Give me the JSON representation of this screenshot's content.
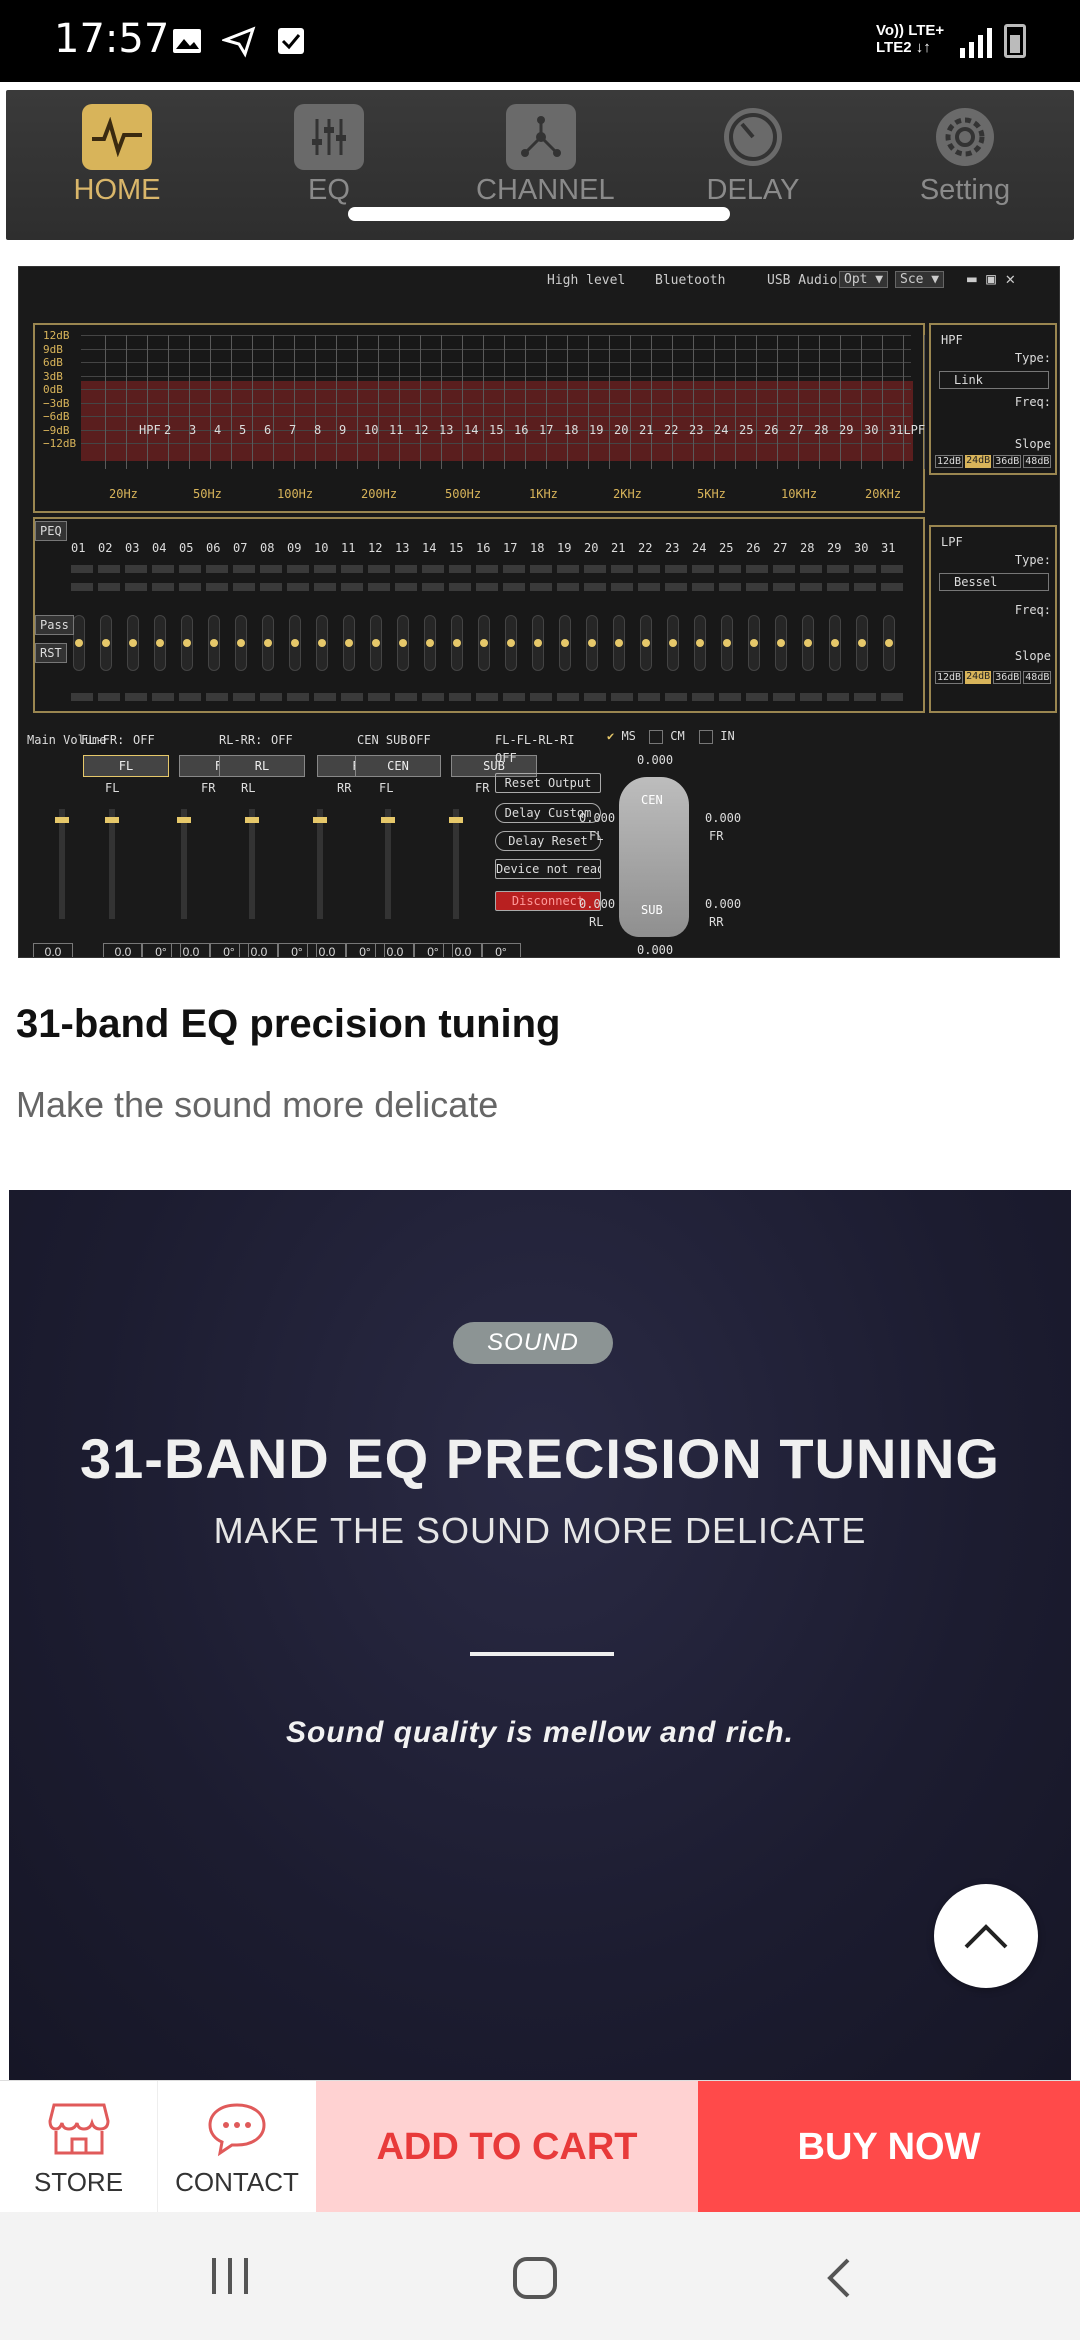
{
  "status_bar": {
    "time": "17:57",
    "network_line1": "Vo)) LTE+",
    "network_line2": "LTE2 ↓↑"
  },
  "app_nav": {
    "items": [
      {
        "label": "HOME",
        "icon": "pulse-icon",
        "active": true
      },
      {
        "label": "EQ",
        "icon": "sliders-icon",
        "active": false
      },
      {
        "label": "CHANNEL",
        "icon": "channel-icon",
        "active": false
      },
      {
        "label": "DELAY",
        "icon": "clock-icon",
        "active": false
      },
      {
        "label": "Setting",
        "icon": "gear-icon",
        "active": false
      }
    ]
  },
  "eq_screenshot": {
    "top_bar": {
      "high_level": "High level",
      "bluetooth": "Bluetooth",
      "usb_audio": "USB Audio",
      "opt": "Opt ▼",
      "sce": "Sce ▼"
    },
    "db_labels": [
      "12dB",
      "9dB",
      "6dB",
      "3dB",
      "0dB",
      "−3dB",
      "−6dB",
      "−9dB",
      "−12dB"
    ],
    "hz_labels": [
      "20Hz",
      "50Hz",
      "100Hz",
      "200Hz",
      "500Hz",
      "1KHz",
      "2KHz",
      "5KHz",
      "10KHz",
      "20KHz"
    ],
    "band_markers": [
      "HPF",
      "2",
      "3",
      "4",
      "5",
      "6",
      "7",
      "8",
      "9",
      "10",
      "11",
      "12",
      "13",
      "14",
      "15",
      "16",
      "17",
      "18",
      "19",
      "20",
      "21",
      "22",
      "23",
      "24",
      "25",
      "26",
      "27",
      "28",
      "29",
      "30",
      "31LPF"
    ],
    "band_numbers": [
      "01",
      "02",
      "03",
      "04",
      "05",
      "06",
      "07",
      "08",
      "09",
      "10",
      "11",
      "12",
      "13",
      "14",
      "15",
      "16",
      "17",
      "18",
      "19",
      "20",
      "21",
      "22",
      "23",
      "24",
      "25",
      "26",
      "27",
      "28",
      "29",
      "30",
      "31"
    ],
    "buttons": {
      "peq": "PEQ",
      "pass": "Pass",
      "rst": "RST"
    },
    "hpf": {
      "title": "HPF",
      "type_label": "Type:",
      "type_value": "Link",
      "freq_label": "Freq:",
      "slope_label": "Slope",
      "slopes": [
        "12dB",
        "24dB",
        "36dB",
        "48dB"
      ]
    },
    "lpf": {
      "title": "LPF",
      "type_label": "Type:",
      "type_value": "Bessel",
      "freq_label": "Freq:",
      "slope_label": "Slope",
      "slopes": [
        "12dB",
        "24dB",
        "36dB",
        "48dB"
      ]
    },
    "mixer": {
      "main_volume": "Main Volume",
      "main_value": "0.0",
      "groups": [
        {
          "label": "FL-FR:",
          "mode": "OFF",
          "btn1": "FL",
          "btn2": "FR",
          "sel1": "FL",
          "sel2": "FR"
        },
        {
          "label": "RL-RR:",
          "mode": "OFF",
          "btn1": "RL",
          "btn2": "RR",
          "sel1": "RL",
          "sel2": "RR"
        },
        {
          "label": "CEN SUB:",
          "mode": "OFF",
          "btn1": "CEN",
          "btn2": "SUB",
          "sel1": "FL",
          "sel2": "FR"
        }
      ],
      "channel_values": [
        "0.0",
        "0°"
      ],
      "right": {
        "label": "FL-FL-RL-RI",
        "mode": "OFF",
        "reset_output": "Reset Output",
        "delay_custom": "Delay Custom",
        "delay_reset": "Delay Reset",
        "device": "Device not ready",
        "disconnect": "Disconnect",
        "ms": "MS",
        "cm": "CM",
        "in": "IN"
      },
      "car": {
        "cen": "CEN",
        "sub": "SUB",
        "fl": "FL",
        "fr": "FR",
        "rl": "RL",
        "rr": "RR",
        "val": "0.000"
      }
    }
  },
  "section": {
    "title": "31-band EQ precision tuning",
    "subtitle": "Make the sound more delicate"
  },
  "promo": {
    "tag": "SOUND",
    "headline": "31-BAND EQ PRECISION TUNING",
    "subhead": "MAKE THE SOUND MORE DELICATE",
    "tagline": "Sound quality is mellow and rich."
  },
  "action_bar": {
    "store": "STORE",
    "contact": "CONTACT",
    "add_to_cart": "ADD TO CART",
    "buy_now": "BUY NOW"
  },
  "colors": {
    "accent_red": "#ff4a4a",
    "accent_pink": "#ffd2d2",
    "gold": "#d8b45a"
  }
}
